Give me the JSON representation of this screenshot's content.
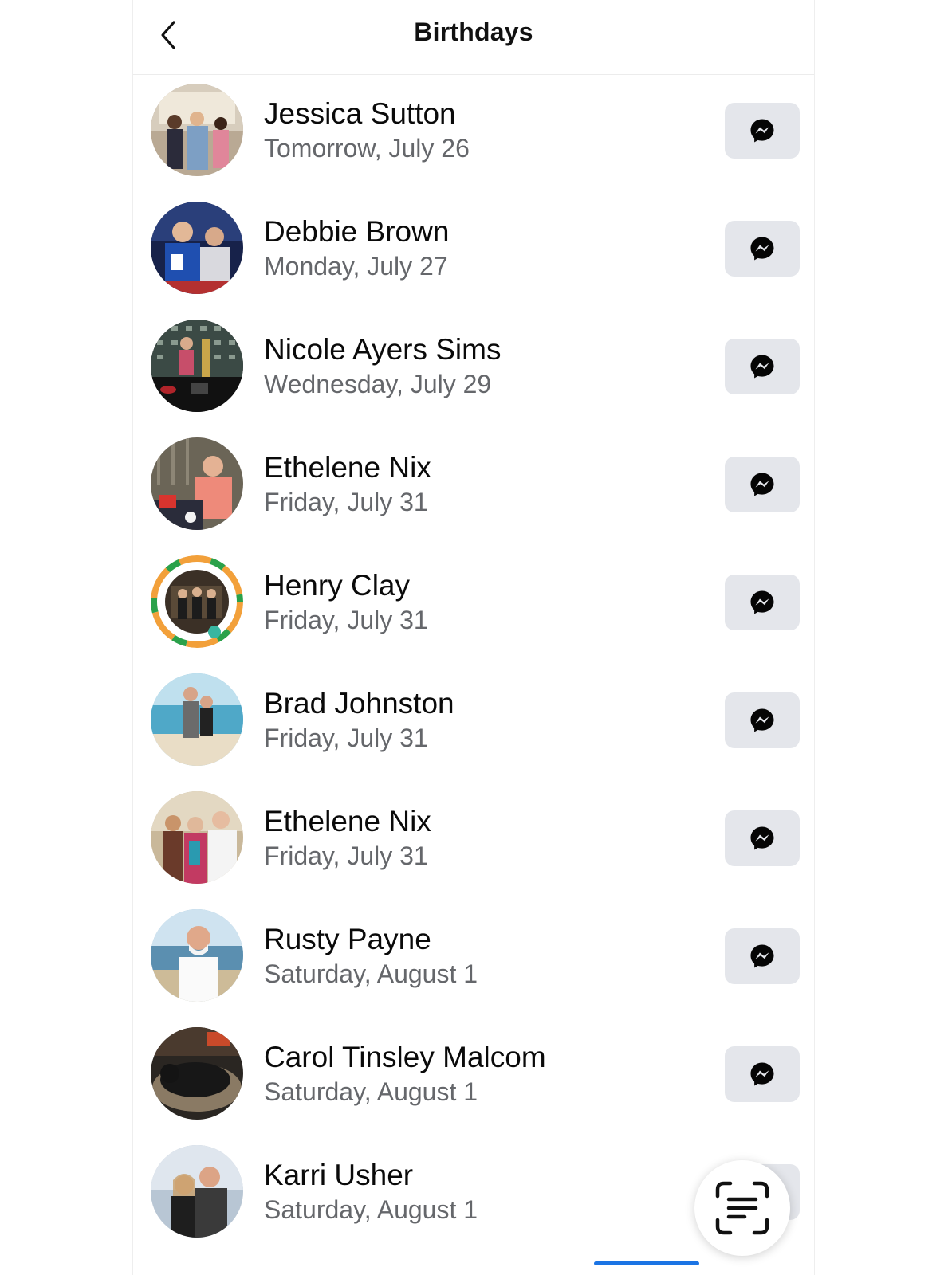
{
  "header": {
    "title": "Birthdays",
    "back_icon": "chevron-left-icon"
  },
  "colors": {
    "button_bg": "#e4e6eb",
    "secondary_text": "#65676b",
    "accent": "#1b74e4"
  },
  "birthdays": [
    {
      "name": "Jessica Sutton",
      "date": "Tomorrow, July 26",
      "action_icon": "messenger-icon"
    },
    {
      "name": "Debbie Brown",
      "date": "Monday, July 27",
      "action_icon": "messenger-icon"
    },
    {
      "name": "Nicole Ayers Sims",
      "date": "Wednesday, July 29",
      "action_icon": "messenger-icon"
    },
    {
      "name": "Ethelene Nix",
      "date": "Friday, July 31",
      "action_icon": "messenger-icon"
    },
    {
      "name": "Henry Clay",
      "date": "Friday, July 31",
      "action_icon": "messenger-icon"
    },
    {
      "name": "Brad Johnston",
      "date": "Friday, July 31",
      "action_icon": "messenger-icon"
    },
    {
      "name": "Ethelene Nix",
      "date": "Friday, July 31",
      "action_icon": "messenger-icon"
    },
    {
      "name": "Rusty Payne",
      "date": "Saturday, August 1",
      "action_icon": "messenger-icon"
    },
    {
      "name": "Carol Tinsley Malcom",
      "date": "Saturday, August 1",
      "action_icon": "messenger-icon"
    },
    {
      "name": "Karri Usher",
      "date": "Saturday, August 1",
      "action_icon": "messenger-icon"
    }
  ],
  "overlay": {
    "scan_icon": "text-scan-icon"
  }
}
